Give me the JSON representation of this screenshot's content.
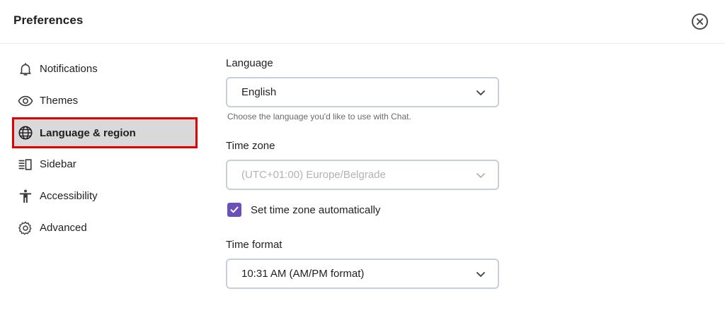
{
  "header": {
    "title": "Preferences",
    "close_icon": "close-circle-icon"
  },
  "sidebar": {
    "items": [
      {
        "label": "Notifications",
        "icon": "bell-icon"
      },
      {
        "label": "Themes",
        "icon": "eye-icon"
      },
      {
        "label": "Language & region",
        "icon": "globe-icon",
        "active": true
      },
      {
        "label": "Sidebar",
        "icon": "sidebar-layout-icon"
      },
      {
        "label": "Accessibility",
        "icon": "accessibility-person-icon"
      },
      {
        "label": "Advanced",
        "icon": "gear-icon"
      }
    ],
    "active_highlight_color": "#e00000"
  },
  "main": {
    "language": {
      "label": "Language",
      "value": "English",
      "hint": "Choose the language you'd like to use with Chat."
    },
    "timezone": {
      "label": "Time zone",
      "value": "(UTC+01:00) Europe/Belgrade",
      "disabled": true,
      "auto_label": "Set time zone automatically",
      "auto_checked": true
    },
    "time_format": {
      "label": "Time format",
      "value": "10:31 AM (AM/PM format)"
    }
  },
  "colors": {
    "checkbox": "#6b4fbb",
    "select_border": "#c7d0da",
    "active_bg": "#d9d9db"
  }
}
